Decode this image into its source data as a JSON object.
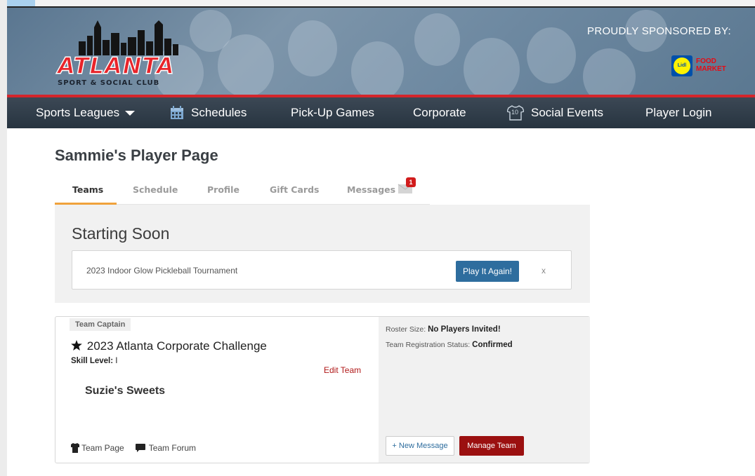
{
  "header": {
    "logo_text": "ATLANTA",
    "logo_sub": "SPORT & SOCIAL CLUB",
    "sponsor_label": "PROUDLY SPONSORED BY:",
    "sponsor_brand": "Lidl",
    "sponsor_text_1": "FOOD",
    "sponsor_text_2": "MARKET"
  },
  "nav": {
    "sports_leagues": "Sports Leagues",
    "schedules": "Schedules",
    "pickup": "Pick-Up Games",
    "corporate": "Corporate",
    "social_events": "Social Events",
    "social_icon_number": "10",
    "player_login": "Player Login"
  },
  "page": {
    "title": "Sammie's Player Page"
  },
  "tabs": {
    "teams": "Teams",
    "schedule": "Schedule",
    "profile": "Profile",
    "gift_cards": "Gift Cards",
    "messages": "Messages",
    "messages_badge": "1"
  },
  "starting_soon": {
    "title": "Starting Soon",
    "event_name": "2023 Indoor Glow Pickleball Tournament",
    "play_button": "Play It Again!",
    "close": "x"
  },
  "team_card": {
    "role_badge": "Team Captain",
    "league_name": "2023 Atlanta Corporate Challenge",
    "skill_label": "Skill Level:",
    "skill_value": "I",
    "edit_team": "Edit Team",
    "team_name": "Suzie's Sweets",
    "team_page_link": "Team Page",
    "team_forum_link": "Team Forum",
    "roster_label": "Roster Size:",
    "roster_value": "No Players Invited!",
    "status_label": "Team Registration Status:",
    "status_value": "Confirmed",
    "new_message_button": "+ New Message",
    "manage_team_button": "Manage Team"
  },
  "colors": {
    "nav_bg": "#2f3c48",
    "accent_red": "#d4252b",
    "play_button_blue": "#2e6d9e",
    "manage_button_red": "#9b1010",
    "tab_active_underline": "#f0a23c"
  }
}
